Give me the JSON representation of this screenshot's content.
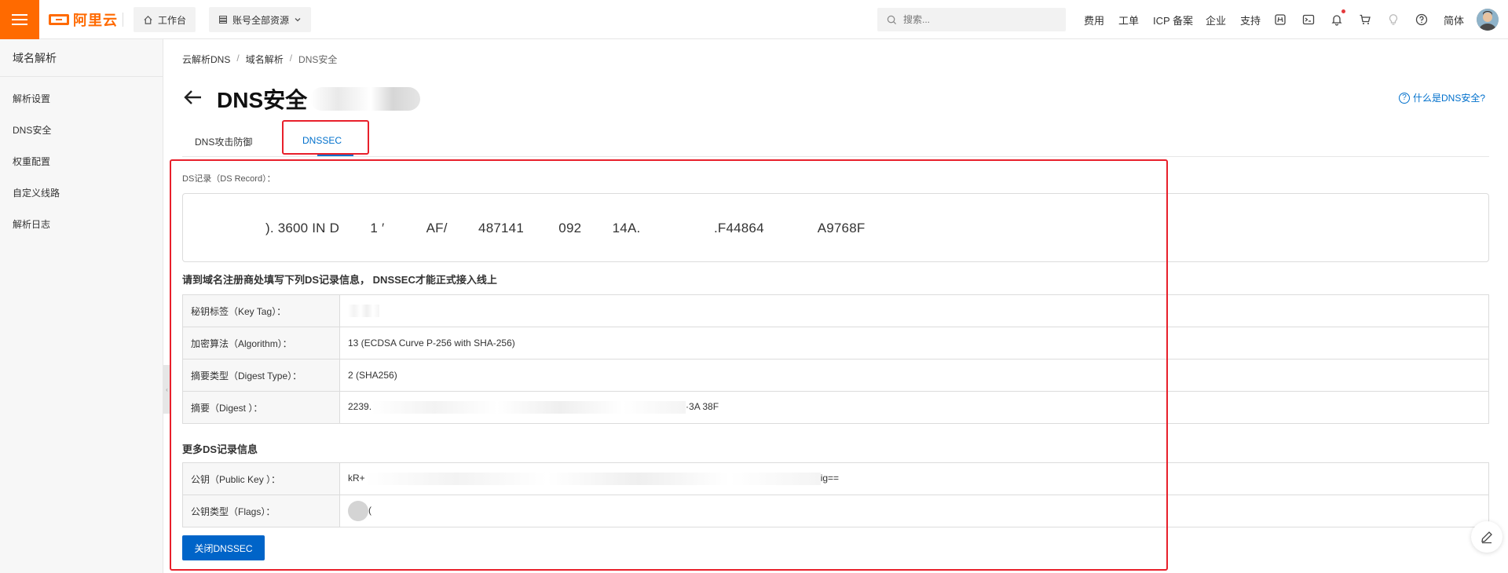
{
  "header": {
    "logo_text": "阿里云",
    "workbench_label": "工作台",
    "resources_label": "账号全部资源",
    "search_placeholder": "搜索...",
    "links": [
      "费用",
      "工单",
      "ICP 备案",
      "企业",
      "支持"
    ],
    "lang": "简体"
  },
  "sidebar": {
    "title": "域名解析",
    "items": [
      "解析设置",
      "DNS安全",
      "权重配置",
      "自定义线路",
      "解析日志"
    ]
  },
  "breadcrumb": {
    "root": "云解析DNS",
    "mid": "域名解析",
    "current": "DNS安全"
  },
  "page": {
    "title": "DNS安全",
    "help_label": "什么是DNS安全?"
  },
  "tabs": [
    "DNS攻击防御",
    "DNSSEC"
  ],
  "ds": {
    "label": "DS记录（DS Record）：",
    "record_text": "). 3600 IN D        1 ′           AF/        487141         092        14A.                   .F44864              A9768F"
  },
  "registrar_title": "请到域名注册商处填写下列DS记录信息， DNSSEC才能正式接入线上",
  "ds_table": [
    {
      "key": "秘钥标签（Key Tag）：",
      "value": ""
    },
    {
      "key": "加密算法（Algorithm）：",
      "value": "13 (ECDSA Curve P-256 with SHA-256)"
    },
    {
      "key": "摘要类型（Digest Type）：",
      "value": "2 (SHA256)"
    },
    {
      "key": "摘要（Digest ）：",
      "value_start": "2239.",
      "value_end": "·3A  38F"
    }
  ],
  "more_title": "更多DS记录信息",
  "more_table": [
    {
      "key": "公钥（Public Key ）：",
      "value_start": "kR+",
      "value_end": "ig=="
    },
    {
      "key": "公钥类型（Flags）：",
      "value": "("
    }
  ],
  "close_button": "关闭DNSSEC",
  "colors": {
    "brand": "#ff6a00",
    "link": "#0070cc",
    "primary": "#0064c8",
    "annotation": "#e8202b"
  }
}
